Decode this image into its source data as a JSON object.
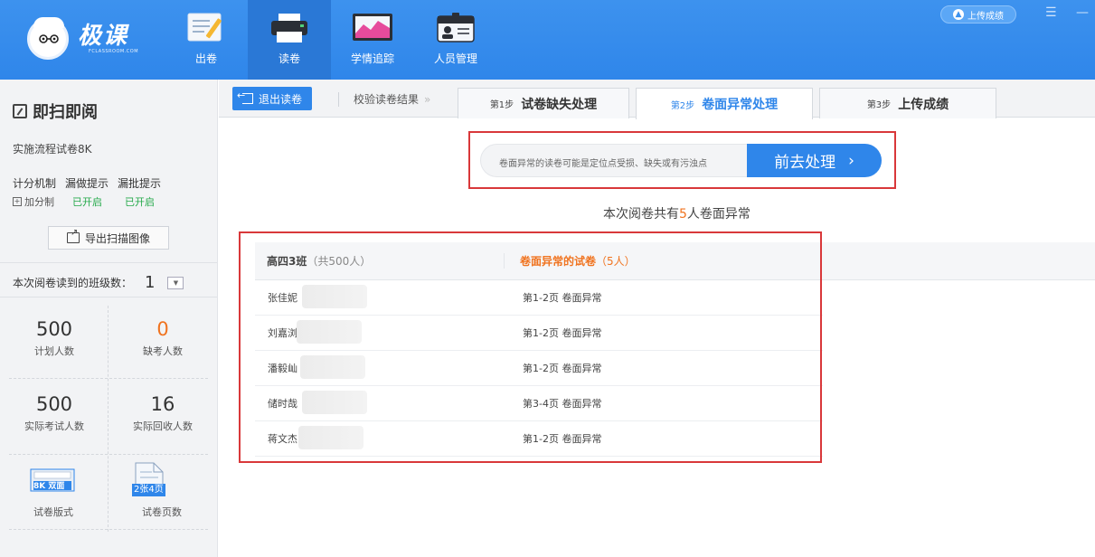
{
  "app": {
    "logo_cn": "极课",
    "logo_en": "FCLASSROOM.COM",
    "nav": [
      {
        "label": "出卷"
      },
      {
        "label": "读卷"
      },
      {
        "label": "学情追踪"
      },
      {
        "label": "人员管理"
      }
    ],
    "upload_label": "上传成绩",
    "minimize": "—"
  },
  "sidebar": {
    "title": "即扫即阅",
    "exam_name": "实施流程试卷8K",
    "settings": [
      {
        "label": "计分机制",
        "value": "加分制"
      },
      {
        "label": "漏做提示",
        "value": "已开启"
      },
      {
        "label": "漏批提示",
        "value": "已开启"
      }
    ],
    "export_label": "导出扫描图像",
    "class_count_label": "本次阅卷读到的班级数：",
    "class_count": "1",
    "stats": [
      {
        "value": "500",
        "label": "计划人数"
      },
      {
        "value": "0",
        "label": "缺考人数"
      },
      {
        "value": "500",
        "label": "实际考试人数"
      },
      {
        "value": "16",
        "label": "实际回收人数"
      }
    ],
    "paper_format_badge": "8K 双面",
    "paper_format_label": "试卷版式",
    "paper_pages_badge": "2张4页",
    "paper_pages_label": "试卷页数"
  },
  "main": {
    "exit_label": "退出读卷",
    "verify_label": "校验读卷结果",
    "steps": [
      {
        "num": "第1步",
        "title": "试卷缺失处理"
      },
      {
        "num": "第2步",
        "title": "卷面异常处理"
      },
      {
        "num": "第3步",
        "title": "上传成绩"
      }
    ],
    "notice_text": "卷面异常的读卷可能是定位点受损、缺失或有污浊点",
    "go_label": "前去处理",
    "summary_prefix": "本次阅卷共有",
    "summary_count": "5",
    "summary_suffix": "人卷面异常",
    "table": {
      "class_name": "高四3班",
      "class_total": "（共500人）",
      "abnormal_header": "卷面异常的试卷",
      "abnormal_count": "（5人）",
      "rows": [
        {
          "name": "张佳妮",
          "issue": "第1-2页 卷面异常"
        },
        {
          "name": "刘嘉浏",
          "issue": "第1-2页 卷面异常"
        },
        {
          "name": "潘毅屾",
          "issue": "第1-2页 卷面异常"
        },
        {
          "name": "储时哉",
          "issue": "第3-4页 卷面异常"
        },
        {
          "name": "蒋文杰",
          "issue": "第1-2页 卷面异常"
        }
      ]
    }
  },
  "colors": {
    "primary": "#2f86ea",
    "accent_orange": "#f0731f",
    "success_green": "#25a94a",
    "annotation_red": "#d9383a"
  }
}
